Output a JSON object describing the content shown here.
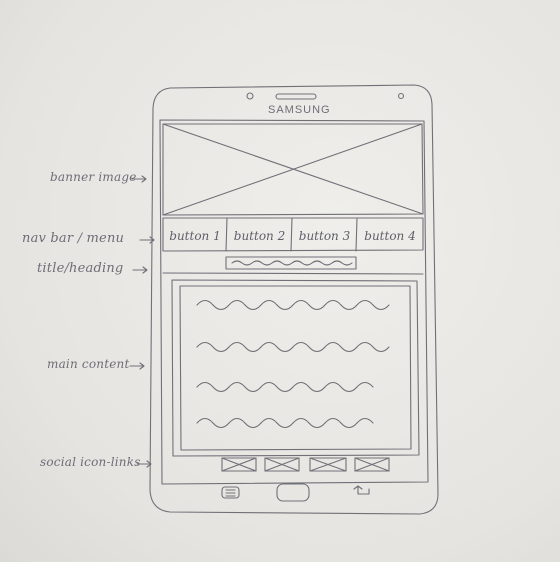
{
  "device": {
    "brand": "SAMSUNG"
  },
  "annotations": {
    "banner": "banner image",
    "nav": "nav bar / menu",
    "title": "title/heading",
    "content": "main content",
    "social": "social icon-links"
  },
  "nav_buttons": [
    "button 1",
    "button 2",
    "button 3",
    "button 4"
  ],
  "colors": {
    "pencil": "#6d6d78",
    "paper": "#e9e7e3"
  }
}
